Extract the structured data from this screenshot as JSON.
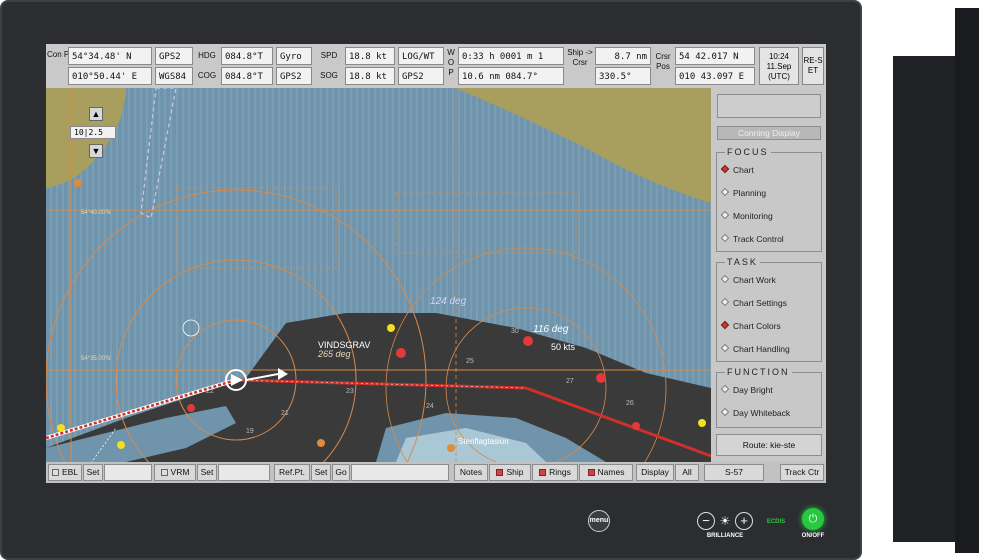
{
  "topbar": {
    "con_pos_label": "Con Pos",
    "lat": "54°34.48' N",
    "lon": "010°50.44' E",
    "pos_source": "GPS2",
    "datum": "WGS84",
    "hdg_label": "HDG",
    "hdg_value": "084.8°T",
    "hdg_source": "Gyro",
    "cog_label": "COG",
    "cog_value": "084.8°T",
    "cog_source": "GPS2",
    "spd_label": "SPD",
    "spd_value": "18.8 kt",
    "spd_source": "LOG/WT",
    "sog_label": "SOG",
    "sog_value": "18.8 kt",
    "sog_source": "GPS2",
    "wop_label": "W O P",
    "wop_time": "0:33 h 0001 m 1",
    "wop_dist": "10.6 nm 084.7°",
    "ship_crsr_label": "Ship -> Crsr",
    "ship_crsr_dist": "8.7 nm",
    "ship_crsr_brg": "330.5°",
    "crsr_pos_label": "Crsr Pos",
    "crsr_lat": "54 42.017 N",
    "crsr_lon": "010 43.097 E",
    "time": "10:24",
    "date": "11.Sep",
    "tz": "(UTC)",
    "reset_label": "RE-SET"
  },
  "map": {
    "range_value": "10|2.5",
    "lat_label_1": "54°40.00'N",
    "lat_label_2": "54°35.00'N",
    "deg_label_1": "124 deg",
    "deg_label_2": "116 deg",
    "deg_label_3": "265 deg",
    "vessel_name": "VINDSGRAV",
    "vessel_name_2": "Stenflagtasion",
    "speed_label": "50 kts",
    "depth_labels": [
      "19",
      "21",
      "23",
      "25",
      "27",
      "30",
      "22",
      "24",
      "26"
    ]
  },
  "panel": {
    "conning_display": "Conning Display",
    "focus_title": "FOCUS",
    "focus_items": [
      "Chart",
      "Planning",
      "Monitoring",
      "Track Control"
    ],
    "task_title": "TASK",
    "task_items": [
      "Chart Work",
      "Chart Settings",
      "Chart Colors",
      "Chart Handling"
    ],
    "function_title": "FUNCTION",
    "function_items": [
      "Day Bright",
      "Day Whiteback"
    ],
    "route_label": "Route: kie-ste"
  },
  "bottombar": {
    "ebl": "EBL",
    "ebl_set": "Set",
    "vrm": "VRM",
    "vrm_set": "Set",
    "refpt": "Ref.Pt.",
    "refpt_set": "Set",
    "go": "Go",
    "notes": "Notes",
    "ship": "Ship",
    "rings": "Rings",
    "names": "Names",
    "display": "Display",
    "all": "All",
    "s57": "S-57",
    "trackctr": "Track Ctr"
  },
  "hardware": {
    "menu": "menu",
    "brilliance": "BRILLIANCE",
    "ecdis": "ECDIS",
    "onoff": "ON/OFF"
  },
  "colors": {
    "sea": "#6f94ab",
    "land": "#a89f5e",
    "shallow": "#3a3a3a",
    "track": "#cc2a2a",
    "power": "#27c93f"
  }
}
